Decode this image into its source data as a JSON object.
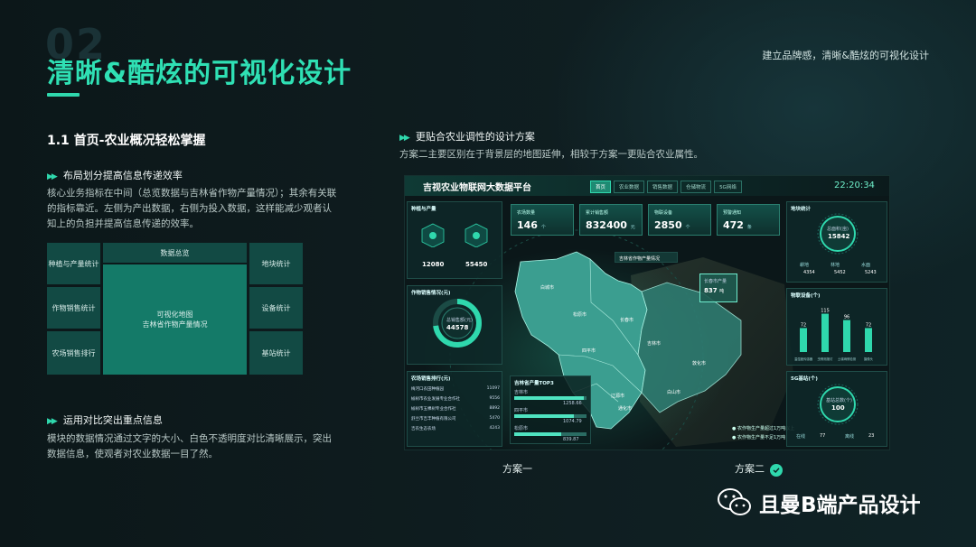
{
  "slide": {
    "ghost_number": "02",
    "title": "清晰&酷炫的可视化设计",
    "top_right": "建立品牌感，清晰&酷炫的可视化设计",
    "section_heading": "1.1 首页-农业概况轻松掌握",
    "point1_title": "布局划分提高信息传递效率",
    "point1_text": "核心业务指标在中间（总览数据与吉林省作物产量情况）；其余有关联的指标靠近。左侧为产出数据，右侧为投入数据，这样能减少观者认知上的负担并提高信息传递的效率。",
    "point2_title": "运用对比突出重点信息",
    "point2_text": "模块的数据情况通过文字的大小、白色不透明度对比清晰展示，突出数据信息，使观者对农业数据一目了然。",
    "right_title": "更贴合农业调性的设计方案",
    "right_text": "方案二主要区别在于背景层的地图延伸，相较于方案一更贴合农业属性。",
    "caption1": "方案一",
    "caption2": "方案二",
    "brand": "且曼B端产品设计"
  },
  "layout_labels": {
    "left": [
      "种植与产量统计",
      "作物销售统计",
      "农场销售排行"
    ],
    "center_top": "数据总览",
    "center": "可视化地图\n吉林省作物产量情况",
    "right": [
      "地块统计",
      "设备统计",
      "基站统计"
    ]
  },
  "dashboard": {
    "title": "吉视农业物联网大数据平台",
    "tabs": [
      "首页",
      "农业数据",
      "销售数据",
      "仓储物流",
      "5G网络"
    ],
    "time": "22:20:34",
    "kpis": [
      {
        "label": "农场数量",
        "value": "146",
        "unit": "个"
      },
      {
        "label": "累计销售额",
        "value": "832400",
        "unit": "元"
      },
      {
        "label": "物联设备",
        "value": "2850",
        "unit": "个"
      },
      {
        "label": "预警通知",
        "value": "472",
        "unit": "条"
      }
    ],
    "plant_title": "种植与产量",
    "plant_values": [
      "12080",
      "55450"
    ],
    "sales_title": "作物销售情况(元)",
    "sales_center_label": "总销售额(元)",
    "sales_center_value": "44578",
    "rank_title": "农场销售排行(元)",
    "rank_items": [
      {
        "name": "梅河口农田种植园",
        "value": "11097"
      },
      {
        "name": "榆树市农业发展专业合作社",
        "value": "9556"
      },
      {
        "name": "榆树市五棵树专业合作社",
        "value": "8892"
      },
      {
        "name": "舒兰市吉丰种植有限公司",
        "value": "5470"
      },
      {
        "name": "吉农生态农场",
        "value": "4243"
      }
    ],
    "map_title": "吉林省作物产量情况",
    "map_popup_label": "长春市产量",
    "map_popup_value": "837",
    "map_popup_unit": "吨",
    "top3_title": "吉林省产量TOP3",
    "top3": [
      {
        "name": "吉林市",
        "value": "1258.66"
      },
      {
        "name": "四平市",
        "value": "1074.79"
      },
      {
        "name": "松原市",
        "value": "839.87"
      }
    ],
    "cities": [
      "白城市",
      "松原市",
      "长春市",
      "吉林市",
      "四平市",
      "辽源市",
      "通化市",
      "白山市",
      "敦化市",
      "延边朝鲜族自治州"
    ],
    "legend": [
      "农作物生产量超过1万吨以上",
      "农作物生产量不足1万吨"
    ],
    "land_title": "地块统计",
    "land_value": "15842",
    "land_label": "总面积(亩)",
    "land_legend": [
      {
        "name": "耕地",
        "value": "4354"
      },
      {
        "name": "林地",
        "value": "5452"
      },
      {
        "name": "水面",
        "value": "5243"
      }
    ],
    "device_title": "物联设备(个)",
    "device_values": [
      "72",
      "115",
      "96",
      "72"
    ],
    "device_labels": [
      "温湿度传感器",
      "虫情测报灯",
      "土壤墒情检测",
      "摄像头"
    ],
    "bs_title": "5G基站(个)",
    "bs_value": "100",
    "bs_label": "基站总数(个)",
    "bs_legend": [
      {
        "name": "在线",
        "value": "77"
      },
      {
        "name": "离线",
        "value": "23"
      }
    ]
  },
  "colors": {
    "accent": "#2fd8ad",
    "title": "#2fe0b4",
    "panel": "#124a44",
    "panel_center": "#147a68"
  }
}
